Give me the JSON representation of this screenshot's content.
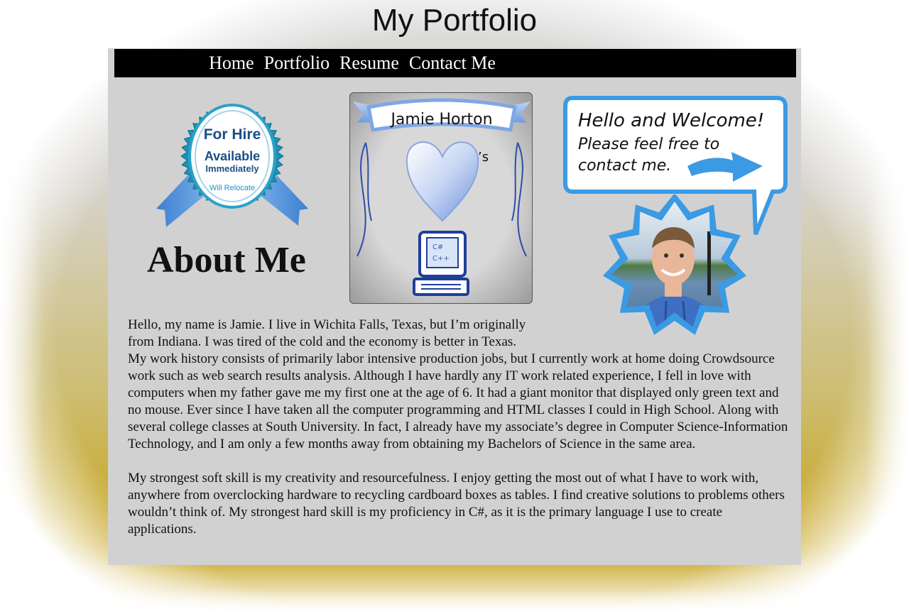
{
  "header": {
    "title": "My Portfolio"
  },
  "nav": {
    "items": [
      "Home",
      "Portfolio",
      "Resume",
      "Contact Me"
    ]
  },
  "badge": {
    "line1": "For Hire",
    "line2": "Available",
    "line3": "Immediately",
    "line4": "Will Relocate"
  },
  "logo": {
    "banner_text": "Jamie Horton",
    "possessive": "’s",
    "screen_text_1": "C#",
    "screen_text_2": "C++"
  },
  "welcome": {
    "line1": "Hello and Welcome!",
    "line2": "Please feel free to",
    "line3": "contact me."
  },
  "about": {
    "heading": "About Me",
    "paragraph1": "Hello, my name is Jamie. I live in Wichita Falls, Texas, but I’m originally from Indiana. I was tired of the cold and the economy is better in Texas.",
    "paragraph2": "My work history consists of primarily labor intensive production jobs, but I currently work at home doing Crowdsource work such as web search results analysis. Although I have hardly any IT work related experience, I fell in love with computers when my father gave me my first one at the age of 6. It had a giant monitor that displayed only green text and no mouse. Ever since I have taken all the computer programming and HTML classes I could in High School. Along with several college classes at South University. In fact, I already have my associate’s degree in Computer Science-Information Technology, and I am only a few months away from obtaining my Bachelors of Science in the same area.",
    "paragraph3": "My strongest soft skill is my creativity and resourcefulness. I enjoy getting the most out of what I have to work with, anywhere from overclocking hardware to recycling cardboard boxes as tables. I find creative solutions to problems others wouldn’t think of. My strongest hard skill is my proficiency in C#, as it is the primary language I use to create applications."
  },
  "colors": {
    "nav_background": "#000000",
    "panel_background": "#d1d1d1",
    "accent_blue": "#3a8fd8",
    "gold": "#c6a21a"
  }
}
